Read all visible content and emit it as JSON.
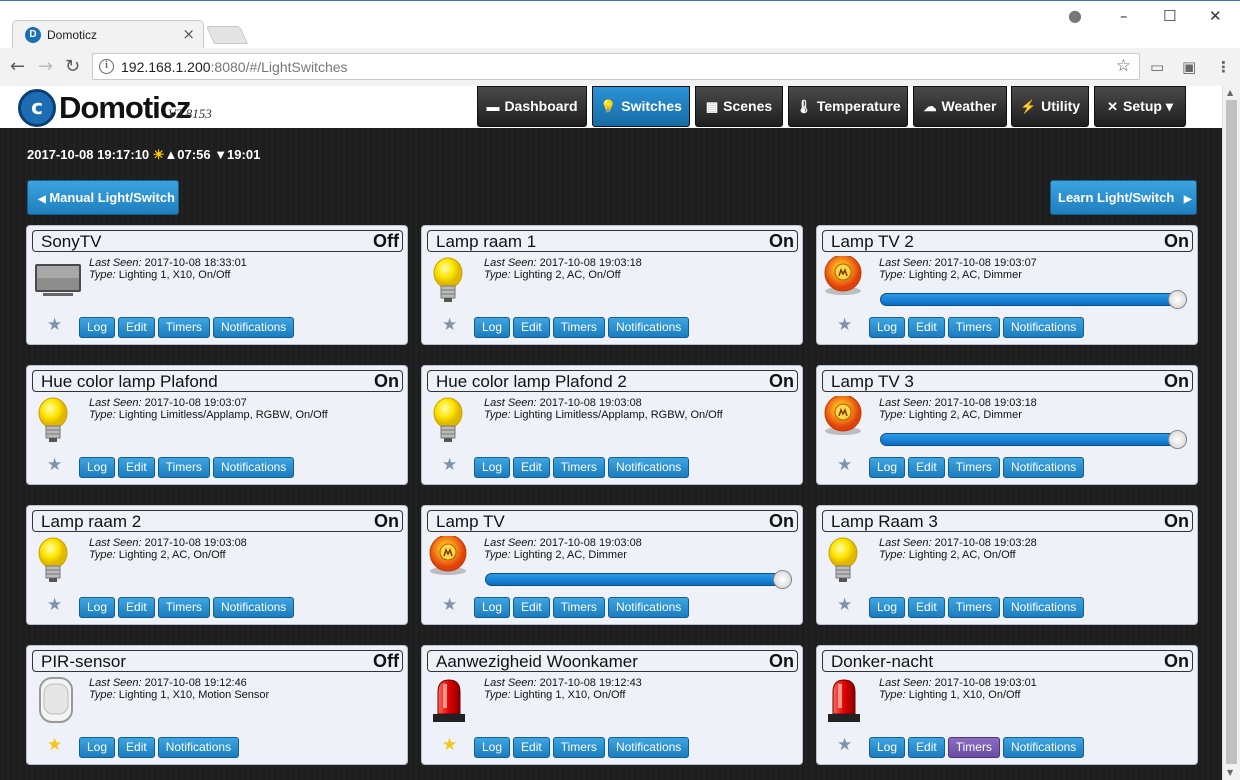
{
  "browser": {
    "tab_title": "Domoticz",
    "url_host": "192.168.1.200",
    "url_rest": ":8080/#/LightSwitches"
  },
  "app": {
    "logo_text": "Domoticz",
    "version": "V3.8153",
    "nav": [
      {
        "label": "Dashboard",
        "icon": "dashboard-icon"
      },
      {
        "label": "Switches",
        "icon": "lightbulb-icon"
      },
      {
        "label": "Scenes",
        "icon": "scenes-icon"
      },
      {
        "label": "Temperature",
        "icon": "thermometer-icon"
      },
      {
        "label": "Weather",
        "icon": "weather-icon"
      },
      {
        "label": "Utility",
        "icon": "utility-icon"
      },
      {
        "label": "Setup ▾",
        "icon": "setup-icon"
      }
    ]
  },
  "header": {
    "datetime": "2017-10-08 19:17:10",
    "sunrise": "▲07:56",
    "sunset": "▼19:01",
    "manual_btn": "Manual Light/Switch",
    "learn_btn": "Learn Light/Switch"
  },
  "labels": {
    "last_seen": "Last Seen:",
    "type": "Type:",
    "log": "Log",
    "edit": "Edit",
    "timers": "Timers",
    "notifications": "Notifications"
  },
  "devices": [
    {
      "name": "SonyTV",
      "status": "Off",
      "last_seen": "2017-10-08 18:33:01",
      "type": "Lighting 1, X10, On/Off",
      "icon": "tv-icon",
      "favorite": false,
      "level": null,
      "timers": true,
      "timers_highlight": false
    },
    {
      "name": "Lamp raam 1",
      "status": "On",
      "last_seen": "2017-10-08 19:03:18",
      "type": "Lighting 2, AC, On/Off",
      "icon": "bulb-icon",
      "favorite": false,
      "level": null,
      "timers": true,
      "timers_highlight": false
    },
    {
      "name": "Lamp TV 2",
      "status": "On",
      "last_seen": "2017-10-08 19:03:07",
      "type": "Lighting 2, AC, Dimmer",
      "icon": "dimmer-bulb-icon",
      "favorite": false,
      "level": 1.0,
      "timers": true,
      "timers_highlight": false
    },
    {
      "name": "Hue color lamp Plafond",
      "status": "On",
      "last_seen": "2017-10-08 19:03:07",
      "type": "Lighting Limitless/Applamp, RGBW, On/Off",
      "icon": "bulb-icon",
      "favorite": false,
      "level": null,
      "timers": true,
      "timers_highlight": false
    },
    {
      "name": "Hue color lamp Plafond 2",
      "status": "On",
      "last_seen": "2017-10-08 19:03:08",
      "type": "Lighting Limitless/Applamp, RGBW, On/Off",
      "icon": "bulb-icon",
      "favorite": false,
      "level": null,
      "timers": true,
      "timers_highlight": false
    },
    {
      "name": "Lamp TV 3",
      "status": "On",
      "last_seen": "2017-10-08 19:03:18",
      "type": "Lighting 2, AC, Dimmer",
      "icon": "dimmer-bulb-icon",
      "favorite": false,
      "level": 1.0,
      "timers": true,
      "timers_highlight": false
    },
    {
      "name": "Lamp raam 2",
      "status": "On",
      "last_seen": "2017-10-08 19:03:08",
      "type": "Lighting 2, AC, On/Off",
      "icon": "bulb-icon",
      "favorite": false,
      "level": null,
      "timers": true,
      "timers_highlight": false
    },
    {
      "name": "Lamp TV",
      "status": "On",
      "last_seen": "2017-10-08 19:03:08",
      "type": "Lighting 2, AC, Dimmer",
      "icon": "dimmer-bulb-icon",
      "favorite": false,
      "level": 1.0,
      "timers": true,
      "timers_highlight": false
    },
    {
      "name": "Lamp Raam 3",
      "status": "On",
      "last_seen": "2017-10-08 19:03:28",
      "type": "Lighting 2, AC, On/Off",
      "icon": "bulb-icon",
      "favorite": false,
      "level": null,
      "timers": true,
      "timers_highlight": false
    },
    {
      "name": "PIR-sensor",
      "status": "Off",
      "last_seen": "2017-10-08 19:12:46",
      "type": "Lighting 1, X10, Motion Sensor",
      "icon": "motion-sensor-icon",
      "favorite": true,
      "level": null,
      "timers": false,
      "timers_highlight": false
    },
    {
      "name": "Aanwezigheid Woonkamer",
      "status": "On",
      "last_seen": "2017-10-08 19:12:43",
      "type": "Lighting 1, X10, On/Off",
      "icon": "siren-icon",
      "favorite": true,
      "level": null,
      "timers": true,
      "timers_highlight": false
    },
    {
      "name": "Donker-nacht",
      "status": "On",
      "last_seen": "2017-10-08 19:03:01",
      "type": "Lighting 1, X10, On/Off",
      "icon": "siren-icon",
      "favorite": false,
      "level": null,
      "timers": true,
      "timers_highlight": true
    }
  ]
}
